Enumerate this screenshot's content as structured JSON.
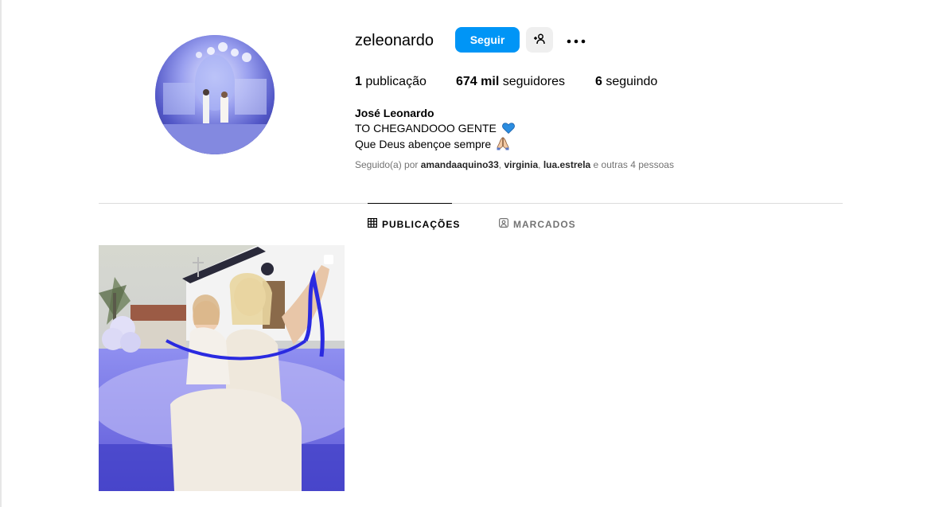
{
  "profile": {
    "username": "zeleonardo",
    "follow_label": "Seguir",
    "icons": {
      "suggest": "person-plus-icon",
      "more": "more-options-icon"
    },
    "stats": {
      "posts_count": "1",
      "posts_label": "publicação",
      "followers_count": "674 mil",
      "followers_label": "seguidores",
      "following_count": "6",
      "following_label": "seguindo"
    },
    "bio": {
      "name": "José Leonardo",
      "line1": "TO CHEGANDOOO GENTE",
      "line2": "Que Deus abençoe sempre"
    },
    "followed_by": {
      "prefix": "Seguido(a) por",
      "users": [
        "amandaaquino33",
        "virginia",
        "lua.estrela"
      ],
      "suffix": "e outras 4 pessoas"
    }
  },
  "tabs": [
    {
      "label": "PUBLICAÇÕES",
      "icon": "grid-icon",
      "active": true
    },
    {
      "label": "MARCADOS",
      "icon": "tagged-icon",
      "active": false
    }
  ],
  "colors": {
    "primary_button": "#0095f6",
    "secondary_button": "#efefef",
    "muted_text": "#737373",
    "divider": "#dbdbdb"
  }
}
